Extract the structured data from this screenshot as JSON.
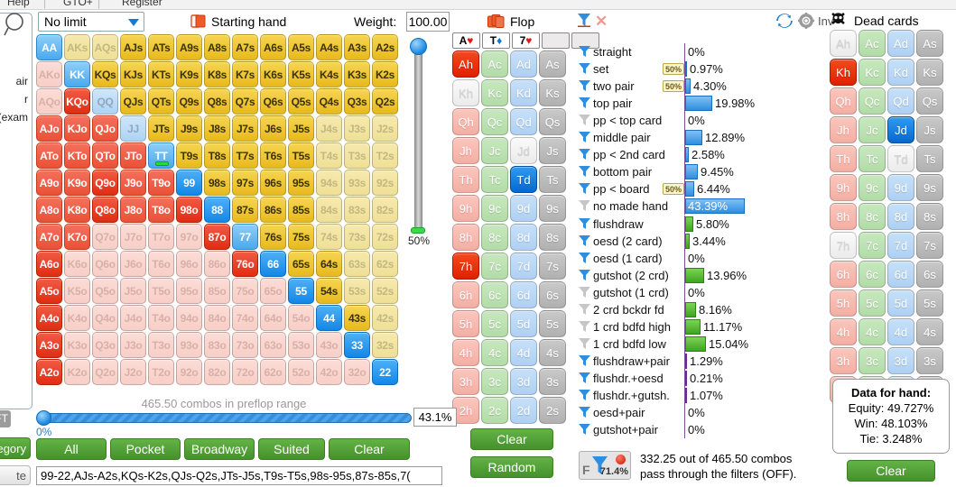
{
  "menu": {
    "items": [
      "Help",
      "GTO+",
      "Register"
    ]
  },
  "toolbar": {
    "limit_value": "No limit",
    "starting_hand_label": "Starting hand",
    "weight_label": "Weight:",
    "weight_value": "100.00",
    "refresh_icon": "refresh-icon",
    "gear_icon": "gear-icon",
    "inv_label": "Inv",
    "dead_cards_label": "Dead cards",
    "skull_icon": "skull-icon",
    "magnifier_icon": "search-icon"
  },
  "left_panel": {
    "lines": [
      "air",
      "r",
      "(exam"
    ],
    "ft_badge": "FT",
    "category_button": "egory",
    "delete_button": "te"
  },
  "weight_slider": {
    "value_label": "50%"
  },
  "matrix": {
    "ranks": [
      "A",
      "K",
      "Q",
      "J",
      "T",
      "9",
      "8",
      "7",
      "6",
      "5",
      "4",
      "3",
      "2"
    ],
    "cells": [
      [
        "AA:pkM",
        "AKs:su",
        "AQs:su",
        "AJs:suA",
        "ATs:suA",
        "A9s:suA",
        "A8s:suA",
        "A7s:suA",
        "A6s:suA",
        "A5s:suA",
        "A4s:suA",
        "A3s:suA",
        "A2s:suA"
      ],
      [
        "AKo:of",
        "KK:pkM",
        "KQs:suA",
        "KJs:suA",
        "KTs:suA",
        "K9s:suA",
        "K8s:suA",
        "K7s:suA",
        "K6s:suA",
        "K5s:suA",
        "K4s:suA",
        "K3s:suA",
        "K2s:suA"
      ],
      [
        "AQo:of",
        "KQo:ofA",
        "QQ:pk",
        "QJs:suA",
        "QTs:suA",
        "Q9s:suA",
        "Q8s:suA",
        "Q7s:suA",
        "Q6s:suA",
        "Q5s:suA",
        "Q4s:suA",
        "Q3s:suA",
        "Q2s:suA"
      ],
      [
        "AJo:ofM",
        "KJo:ofM",
        "QJo:ofM",
        "JJ:pk",
        "JTs:suA",
        "J9s:suA",
        "J8s:suA",
        "J7s:suA",
        "J6s:suA",
        "J5s:suA",
        "J4s:su",
        "J3s:su",
        "J2s:su"
      ],
      [
        "ATo:ofM",
        "KTo:ofM",
        "QTo:ofM",
        "JTo:ofM",
        "TT:pkM*",
        "T9s:suA",
        "T8s:suA",
        "T7s:suA",
        "T6s:suA",
        "T5s:suA",
        "T4s:su",
        "T3s:su",
        "T2s:su"
      ],
      [
        "A9o:ofM",
        "K9o:ofM",
        "Q9o:ofA",
        "J9o:ofM",
        "T9o:ofM",
        "99:pkA",
        "98s:suA",
        "97s:suA",
        "96s:suA",
        "95s:suA",
        "94s:su",
        "93s:su",
        "92s:su"
      ],
      [
        "A8o:ofM",
        "K8o:ofM",
        "Q8o:ofA",
        "J8o:ofM",
        "T8o:ofM",
        "98o:ofA",
        "88:pkA",
        "87s:suA",
        "86s:suA",
        "85s:suA",
        "84s:su",
        "83s:su",
        "82s:su"
      ],
      [
        "A7o:ofM",
        "K7o:ofM",
        "Q7o:of",
        "J7o:of",
        "T7o:of",
        "97o:of",
        "87o:ofA",
        "77:pkM",
        "76s:suA",
        "75s:suA",
        "74s:su",
        "73s:su",
        "72s:su"
      ],
      [
        "A6o:ofA",
        "K6o:of",
        "Q6o:of",
        "J6o:of",
        "T6o:of",
        "96o:of",
        "86o:of",
        "76o:ofA",
        "66:pkA",
        "65s:suA",
        "64s:suA",
        "63s:su",
        "62s:su"
      ],
      [
        "A5o:ofA",
        "K5o:of",
        "Q5o:of",
        "J5o:of",
        "T5o:of",
        "95o:of",
        "85o:of",
        "75o:of",
        "65o:of",
        "55:pkA",
        "54s:suA",
        "53s:su",
        "52s:su"
      ],
      [
        "A4o:ofA",
        "K4o:of",
        "Q4o:of",
        "J4o:of",
        "T4o:of",
        "94o:of",
        "84o:of",
        "74o:of",
        "64o:of",
        "54o:of",
        "44:pkA",
        "43s:suA",
        "42s:su"
      ],
      [
        "A3o:ofA",
        "K3o:of",
        "Q3o:of",
        "J3o:of",
        "T3o:of",
        "93o:of",
        "83o:of",
        "73o:of",
        "63o:of",
        "53o:of",
        "43o:of",
        "33:pkA",
        "32s:su"
      ],
      [
        "A2o:ofA",
        "K2o:of",
        "Q2o:of",
        "J2o:of",
        "T2o:of",
        "92o:of",
        "82o:of",
        "72o:of",
        "62o:of",
        "52o:of",
        "42o:of",
        "32o:of",
        "22:pkA"
      ]
    ]
  },
  "board": {
    "title": "Flop",
    "cards": [
      {
        "rank": "A",
        "suit": "h"
      },
      {
        "rank": "T",
        "suit": "d"
      },
      {
        "rank": "7",
        "suit": "h"
      },
      {
        "rank": "",
        "suit": ""
      },
      {
        "rank": "",
        "suit": ""
      }
    ],
    "deck_ranks": [
      "A",
      "K",
      "Q",
      "J",
      "T",
      "9",
      "8",
      "7",
      "6",
      "5",
      "4",
      "3",
      "2"
    ],
    "deck_suits": [
      "h",
      "c",
      "d",
      "s"
    ],
    "selected": [
      "Ah",
      "Td",
      "7h"
    ],
    "unavailable": [
      "Kh",
      "Jd"
    ],
    "clear_button": "Clear",
    "random_button": "Random"
  },
  "dead_cards": {
    "deck_ranks": [
      "A",
      "K",
      "Q",
      "J",
      "T",
      "9",
      "8",
      "7",
      "6",
      "5",
      "4",
      "3",
      "2"
    ],
    "deck_suits": [
      "h",
      "c",
      "d",
      "s"
    ],
    "selected": [
      "Kh",
      "Jd"
    ],
    "unavailable": [
      "Ah",
      "Td",
      "7h"
    ],
    "clear_button": "Clear"
  },
  "filters": {
    "made_hands": [
      {
        "label": "straight",
        "badge": "",
        "value": "0%",
        "pct": 0.0,
        "color": "blue",
        "on": true
      },
      {
        "label": "set",
        "badge": "50%",
        "value": "0.97%",
        "pct": 0.97,
        "color": "blue",
        "on": true
      },
      {
        "label": "two pair",
        "badge": "50%",
        "value": "4.30%",
        "pct": 4.3,
        "color": "blue",
        "on": true
      },
      {
        "label": "top pair",
        "badge": "",
        "value": "19.98%",
        "pct": 19.98,
        "color": "blue",
        "on": true
      },
      {
        "label": "pp < top card",
        "badge": "",
        "value": "0%",
        "pct": 0.0,
        "color": "blue",
        "on": false
      },
      {
        "label": "middle pair",
        "badge": "",
        "value": "12.89%",
        "pct": 12.89,
        "color": "blue",
        "on": true
      },
      {
        "label": "pp < 2nd card",
        "badge": "",
        "value": "2.58%",
        "pct": 2.58,
        "color": "blue",
        "on": true
      },
      {
        "label": "bottom pair",
        "badge": "",
        "value": "9.45%",
        "pct": 9.45,
        "color": "blue",
        "on": true
      },
      {
        "label": "pp < board",
        "badge": "50%",
        "value": "6.44%",
        "pct": 6.44,
        "color": "blue",
        "on": true
      },
      {
        "label": "no made hand",
        "badge": "",
        "value": "43.39%",
        "pct": 43.39,
        "color": "blue",
        "on": false
      }
    ],
    "draws": [
      {
        "label": "flushdraw",
        "badge": "",
        "value": "5.80%",
        "pct": 5.8,
        "color": "green",
        "on": true
      },
      {
        "label": "oesd (2 card)",
        "badge": "",
        "value": "3.44%",
        "pct": 3.44,
        "color": "green",
        "on": true
      },
      {
        "label": "oesd (1 card)",
        "badge": "",
        "value": "0%",
        "pct": 0.0,
        "color": "green",
        "on": true
      },
      {
        "label": "gutshot (2 crd)",
        "badge": "",
        "value": "13.96%",
        "pct": 13.96,
        "color": "green",
        "on": true
      },
      {
        "label": "gutshot (1 crd)",
        "badge": "",
        "value": "0%",
        "pct": 0.0,
        "color": "green",
        "on": false
      },
      {
        "label": "2 crd bckdr fd",
        "badge": "",
        "value": "8.16%",
        "pct": 8.16,
        "color": "green",
        "on": false
      },
      {
        "label": "1 crd bdfd high",
        "badge": "",
        "value": "11.17%",
        "pct": 11.17,
        "color": "green",
        "on": false
      },
      {
        "label": "1 crd bdfd low",
        "badge": "",
        "value": "15.04%",
        "pct": 15.04,
        "color": "green",
        "on": false
      }
    ],
    "combos": [
      {
        "label": "flushdraw+pair",
        "badge": "",
        "value": "1.29%",
        "pct": 1.29,
        "color": "purple",
        "on": true
      },
      {
        "label": "flushdr.+oesd",
        "badge": "",
        "value": "0.21%",
        "pct": 0.21,
        "color": "purple",
        "on": true
      },
      {
        "label": "flushdr.+gutsh.",
        "badge": "",
        "value": "1.07%",
        "pct": 1.07,
        "color": "purple",
        "on": true
      },
      {
        "label": "oesd+pair",
        "badge": "",
        "value": "0%",
        "pct": 0.0,
        "color": "purple",
        "on": true
      },
      {
        "label": "gutshot+pair",
        "badge": "",
        "value": "0%",
        "pct": 0.0,
        "color": "purple",
        "on": true
      }
    ]
  },
  "hand_data": {
    "title": "Data for hand:",
    "equity": "Equity: 49.727%",
    "win": "Win: 48.103%",
    "tie": "Tie: 3.248%"
  },
  "range": {
    "combos_label": "465.50 combos in preflop range",
    "zero_label": "0%",
    "percent_value": "43.1%",
    "buttons": [
      "All",
      "Pocket",
      "Broadway",
      "Suited",
      "Clear"
    ],
    "range_text": "99-22,AJs-A2s,KQs-K2s,QJs-Q2s,JTs-J5s,T9s-T5s,98s-95s,87s-85s,7("
  },
  "filter_status": {
    "badge_letter": "F",
    "badge_percent": "71.4%",
    "line1": "332.25 out of 465.50 combos",
    "line2": "pass through the filters (OFF)."
  }
}
